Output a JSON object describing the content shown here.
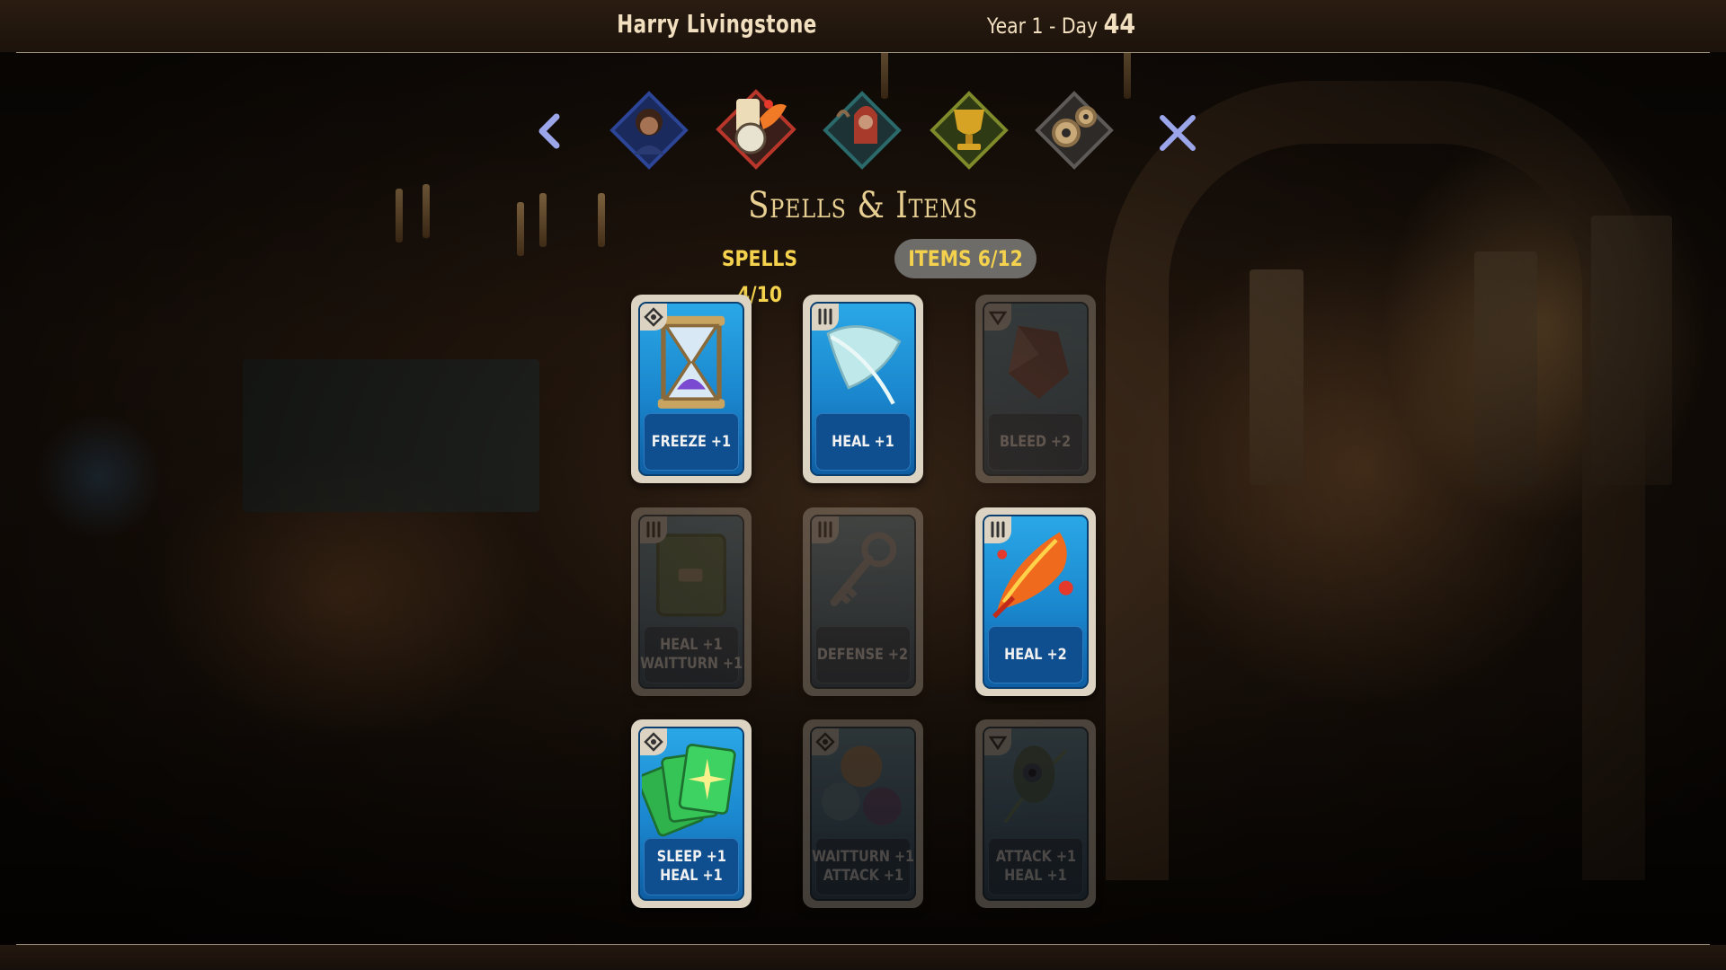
{
  "header": {
    "player_name": "Harry Livingstone",
    "date_prefix": "Year 1 - Day",
    "day_number": "44"
  },
  "nav": {
    "tabs": [
      {
        "name": "character",
        "icon": "character-portrait-icon"
      },
      {
        "name": "spells-items",
        "icon": "spells-items-icon",
        "active": true
      },
      {
        "name": "companions",
        "icon": "companions-icon"
      },
      {
        "name": "trophies",
        "icon": "trophy-icon"
      },
      {
        "name": "settings",
        "icon": "gears-icon"
      }
    ],
    "back_icon": "chevron-left-icon",
    "close_icon": "close-icon"
  },
  "page": {
    "title": "Spells & Items",
    "spells_tab": "SPELLS 4/10",
    "items_tab": "ITEMS 6/12"
  },
  "cards": [
    {
      "lines": [
        "FREEZE +1"
      ],
      "icon": "hourglass-icon",
      "corner": "spell-rune-icon",
      "unlocked": true
    },
    {
      "lines": [
        "HEAL +1"
      ],
      "icon": "feather-icon",
      "corner": "item-tag-icon",
      "unlocked": true
    },
    {
      "lines": [
        "BLEED +2"
      ],
      "icon": "crystal-icon",
      "corner": "heart-rune-icon",
      "unlocked": false
    },
    {
      "lines": [
        "HEAL +1",
        "WAITTURN +1"
      ],
      "icon": "book-icon",
      "corner": "item-tag-icon",
      "unlocked": false
    },
    {
      "lines": [
        "DEFENSE +2"
      ],
      "icon": "key-icon",
      "corner": "item-tag-icon",
      "unlocked": false
    },
    {
      "lines": [
        "HEAL +2"
      ],
      "icon": "phoenix-feather-icon",
      "corner": "item-tag-icon",
      "unlocked": true
    },
    {
      "lines": [
        "SLEEP +1",
        "HEAL +1"
      ],
      "icon": "cards-icon",
      "corner": "spell-rune-icon",
      "unlocked": true
    },
    {
      "lines": [
        "WAITTURN +1",
        "ATTACK +1"
      ],
      "icon": "marbles-icon",
      "corner": "spell-rune-icon",
      "unlocked": false
    },
    {
      "lines": [
        "ATTACK +1",
        "HEAL +1"
      ],
      "icon": "peacock-feather-icon",
      "corner": "heart-rune-icon",
      "unlocked": false
    }
  ],
  "colors": {
    "accent_yellow": "#f4d24d",
    "title_gold": "#e8cf92",
    "card_blue": "#1a86cd",
    "nav_lavender": "#9aa5ea"
  }
}
